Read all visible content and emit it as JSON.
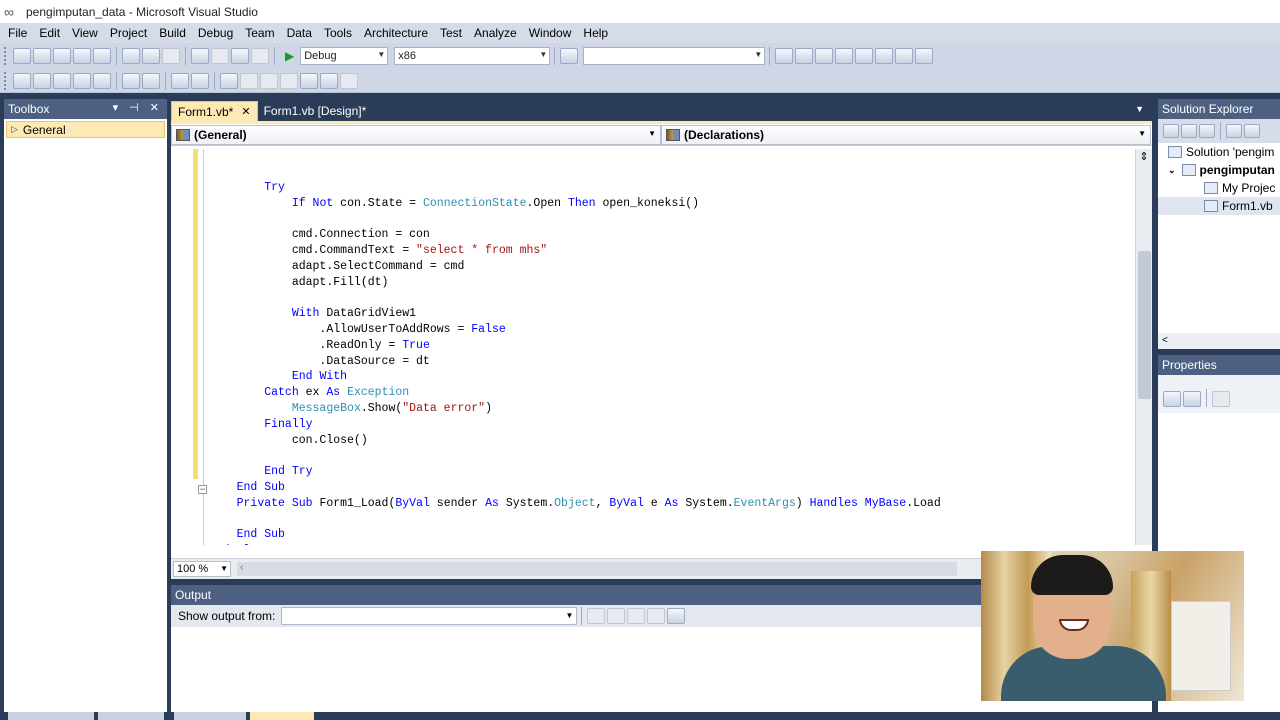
{
  "window": {
    "title": "pengimputan_data - Microsoft Visual Studio"
  },
  "menu": {
    "items": [
      "File",
      "Edit",
      "View",
      "Project",
      "Build",
      "Debug",
      "Team",
      "Data",
      "Tools",
      "Architecture",
      "Test",
      "Analyze",
      "Window",
      "Help"
    ]
  },
  "toolbar": {
    "configuration": "Debug",
    "platform": "x86",
    "find_value": ""
  },
  "toolbox": {
    "title": "Toolbox",
    "group": "General"
  },
  "editor": {
    "tabs": [
      {
        "label": "Form1.vb*",
        "active": true
      },
      {
        "label": "Form1.vb [Design]*",
        "active": false
      }
    ],
    "nav_left": "(General)",
    "nav_right": "(Declarations)",
    "zoom": "100 %",
    "code_lines": [
      "",
      "        Try",
      "            If Not con.State = ConnectionState.Open Then open_koneksi()",
      "",
      "            cmd.Connection = con",
      "            cmd.CommandText = \"select * from mhs\"",
      "            adapt.SelectCommand = cmd",
      "            adapt.Fill(dt)",
      "",
      "            With DataGridView1",
      "                .AllowUserToAddRows = False",
      "                .ReadOnly = True",
      "                .DataSource = dt",
      "            End With",
      "        Catch ex As Exception",
      "            MessageBox.Show(\"Data error\")",
      "        Finally",
      "            con.Close()",
      "",
      "        End Try",
      "    End Sub",
      "    Private Sub Form1_Load(ByVal sender As System.Object, ByVal e As System.EventArgs) Handles MyBase.Load",
      "",
      "    End Sub",
      "End Class"
    ]
  },
  "output": {
    "title": "Output",
    "show_from_label": "Show output from:",
    "show_from_value": ""
  },
  "solution_explorer": {
    "title": "Solution Explorer",
    "items": [
      {
        "label": "Solution 'pengim",
        "indent": 0
      },
      {
        "label": "pengimputan",
        "indent": 1,
        "bold": true
      },
      {
        "label": "My Projec",
        "indent": 2
      },
      {
        "label": "Form1.vb",
        "indent": 2,
        "selected": true
      }
    ]
  },
  "properties": {
    "title": "Properties"
  },
  "colors": {
    "chrome": "#2b3c59",
    "active_tab": "#fde9b3",
    "keyword": "#0000ff",
    "type": "#2b91af",
    "string": "#a31515"
  }
}
